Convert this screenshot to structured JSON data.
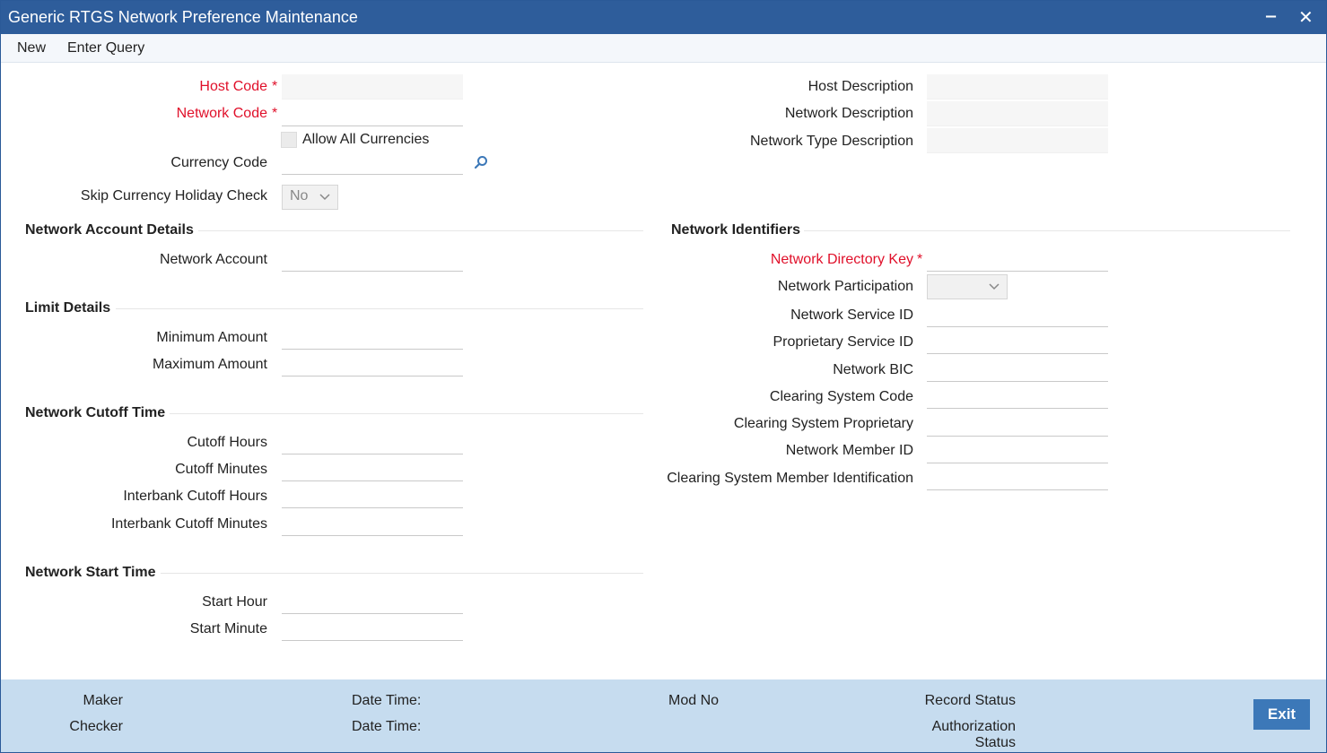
{
  "window": {
    "title": "Generic RTGS Network Preference Maintenance",
    "minimize_icon": "minimize-icon",
    "close_icon": "close-icon"
  },
  "menu": {
    "new": "New",
    "enter_query": "Enter Query"
  },
  "header": {
    "host_code_label": "Host Code",
    "host_code_value": "",
    "network_code_label": "Network Code",
    "network_code_value": "",
    "allow_all_currencies_label": "Allow All Currencies",
    "allow_all_currencies_checked": false,
    "currency_code_label": "Currency Code",
    "currency_code_value": "",
    "skip_currency_holiday_label": "Skip Currency Holiday Check",
    "skip_currency_holiday_value": "No",
    "host_description_label": "Host Description",
    "network_description_label": "Network Description",
    "network_type_description_label": "Network Type Description"
  },
  "network_account_details": {
    "title": "Network Account Details",
    "network_account_label": "Network Account"
  },
  "limit_details": {
    "title": "Limit Details",
    "minimum_amount_label": "Minimum Amount",
    "maximum_amount_label": "Maximum Amount"
  },
  "network_cutoff_time": {
    "title": "Network Cutoff Time",
    "cutoff_hours_label": "Cutoff Hours",
    "cutoff_minutes_label": "Cutoff Minutes",
    "interbank_cutoff_hours_label": "Interbank Cutoff Hours",
    "interbank_cutoff_minutes_label": "Interbank Cutoff Minutes"
  },
  "network_start_time": {
    "title": "Network Start Time",
    "start_hour_label": "Start Hour",
    "start_minute_label": "Start Minute"
  },
  "network_identifiers": {
    "title": "Network Identifiers",
    "network_directory_key_label": "Network Directory Key",
    "network_participation_label": "Network Participation",
    "network_participation_value": "",
    "network_service_id_label": "Network Service ID",
    "proprietary_service_id_label": "Proprietary Service ID",
    "network_bic_label": "Network BIC",
    "clearing_system_code_label": "Clearing System Code",
    "clearing_system_proprietary_label": "Clearing System Proprietary",
    "network_member_id_label": "Network Member ID",
    "clearing_system_member_identification_label": "Clearing System Member Identification"
  },
  "footer": {
    "maker_label": "Maker",
    "checker_label": "Checker",
    "date_time_label_1": "Date Time:",
    "date_time_label_2": "Date Time:",
    "mod_no_label": "Mod No",
    "record_status_label": "Record Status",
    "authorization_status_line1": "Authorization",
    "authorization_status_line2": "Status",
    "exit_label": "Exit"
  },
  "colors": {
    "title_bar": "#2e5d9b",
    "required_label": "#e0102a",
    "footer_bg": "#c6dcef",
    "exit_button": "#3c78b8"
  }
}
